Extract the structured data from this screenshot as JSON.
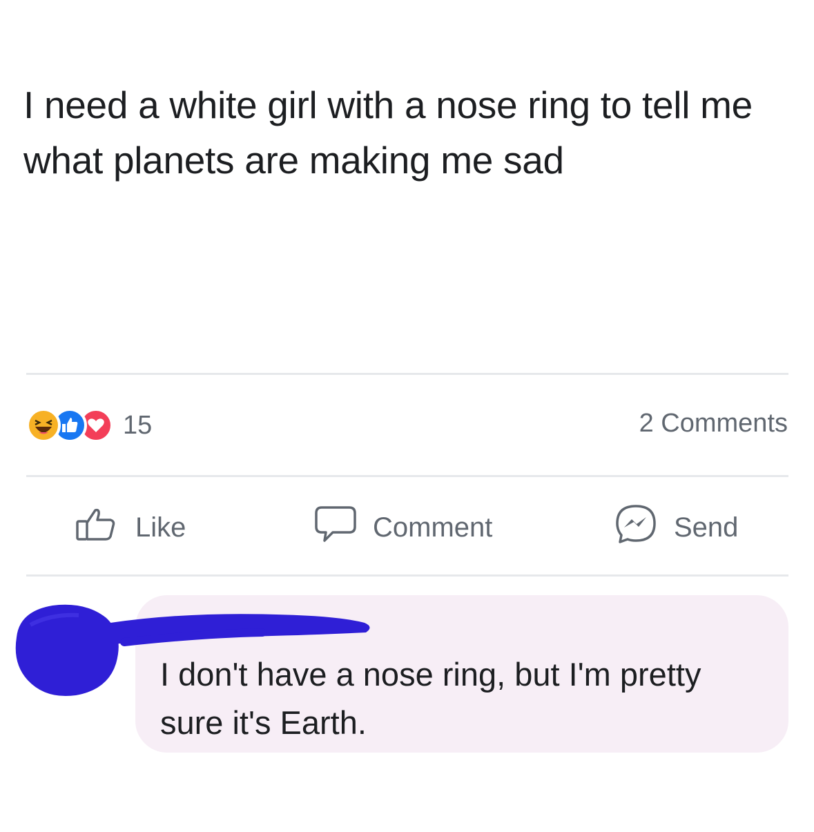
{
  "post": {
    "text": "I need a white girl with a nose ring to tell me what planets are making me sad"
  },
  "reactions": {
    "icons": [
      "haha-icon",
      "like-icon",
      "love-icon"
    ],
    "count": "15",
    "colors": {
      "haha": "#f7b125",
      "like": "#1877f2",
      "love": "#f33e58"
    }
  },
  "comments_count": "2 Comments",
  "actions": {
    "like_label": "Like",
    "comment_label": "Comment",
    "send_label": "Send"
  },
  "comment": {
    "text": "I don't have a nose ring, but I'm pretty sure it's Earth.",
    "redaction_color": "#2f1fd6"
  }
}
